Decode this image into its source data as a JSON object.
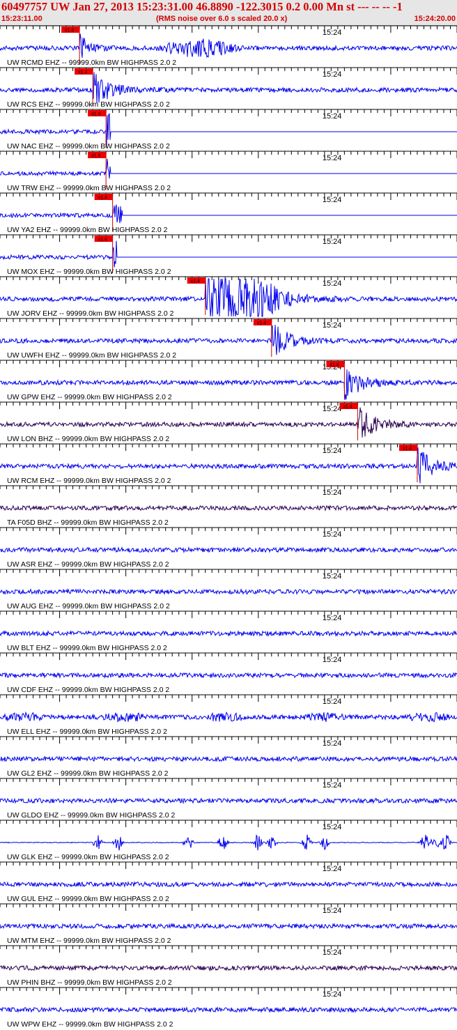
{
  "header": {
    "title": "60497757 UW Jan 27, 2013 15:23:31.00   46.8890 -122.3015  0.2 0.00 Mn st --- -- --   -1",
    "start_time": "15:23:11.00",
    "rms_note": "(RMS noise over 6.0 s scaled 20.0 x)",
    "end_time": "15:24:20.00"
  },
  "colors": {
    "header_text": "#d40000",
    "header_bg": "#e6e6e6",
    "trace_ehz": "#0000ee",
    "trace_bhz": "#2a0050",
    "pick_box": "#ee0000",
    "pick_line": "#cc0000",
    "axis": "#000000"
  },
  "chart_data": {
    "type": "line",
    "title": "60497757 UW Jan 27, 2013 15:23:31.00   46.8890 -122.3015  0.2 0.00 Mn st --- -- --   -1",
    "x_range": [
      "15:23:11.00",
      "15:24:20.00"
    ],
    "x_tick_label": "15:24",
    "pick_label": "x1.4",
    "traces": [
      {
        "label": "UW RCMD EHZ -- 99999.0km BW  HIGHPASS  2.0  2",
        "channel": "EHZ",
        "pick": "15:23:23",
        "pattern": "noisy-event"
      },
      {
        "label": "UW RCS EHZ -- 99999.0km BW  HIGHPASS  2.0  2",
        "channel": "EHZ",
        "pick": "15:23:25",
        "pattern": "event"
      },
      {
        "label": "UW NAC EHZ -- 99999.0km BW  HIGHPASS  2.0  2",
        "channel": "EHZ",
        "pick": "15:23:27",
        "pattern": "spike-flat"
      },
      {
        "label": "UW TRW EHZ -- 99999.0km BW  HIGHPASS  2.0  2",
        "channel": "EHZ",
        "pick": "15:23:27",
        "pattern": "spike-flat"
      },
      {
        "label": "UW YA2 EHZ -- 99999.0km BW  HIGHPASS  2.0  2",
        "channel": "EHZ",
        "pick": "15:23:28",
        "pattern": "burst-flat"
      },
      {
        "label": "UW MOX EHZ -- 99999.0km BW  HIGHPASS  2.0  2",
        "channel": "EHZ",
        "pick": "15:23:28",
        "pattern": "spike-flat"
      },
      {
        "label": "UW JORV EHZ -- 99999.0km BW  HIGHPASS  2.0  2",
        "channel": "EHZ",
        "pick": "15:23:42",
        "pattern": "big-event"
      },
      {
        "label": "UW UWFH EHZ -- 99999.0km BW  HIGHPASS  2.0  2",
        "channel": "EHZ",
        "pick": "15:23:52",
        "pattern": "event"
      },
      {
        "label": "UW GPW EHZ -- 99999.0km BW  HIGHPASS  2.0  2",
        "channel": "EHZ",
        "pick": "15:24:03",
        "pattern": "event"
      },
      {
        "label": "UW LON BHZ -- 99999.0km BW  HIGHPASS  2.0  2",
        "channel": "BHZ",
        "pick": "15:24:05",
        "pattern": "event"
      },
      {
        "label": "UW RCM EHZ -- 99999.0km BW  HIGHPASS  2.0  2",
        "channel": "EHZ",
        "pick": "15:24:14",
        "pattern": "event"
      },
      {
        "label": "TA F05D BHZ -- 99999.0km BW  HIGHPASS  2.0  2",
        "channel": "BHZ",
        "pick": null,
        "pattern": "noise"
      },
      {
        "label": "UW ASR EHZ -- 99999.0km BW  HIGHPASS  2.0  2",
        "channel": "EHZ",
        "pick": null,
        "pattern": "noise"
      },
      {
        "label": "UW AUG EHZ -- 99999.0km BW  HIGHPASS  2.0  2",
        "channel": "EHZ",
        "pick": null,
        "pattern": "noise"
      },
      {
        "label": "UW BLT EHZ -- 99999.0km BW  HIGHPASS  2.0  2",
        "channel": "EHZ",
        "pick": null,
        "pattern": "noise"
      },
      {
        "label": "UW CDF EHZ -- 99999.0km BW  HIGHPASS  2.0  2",
        "channel": "EHZ",
        "pick": null,
        "pattern": "noise"
      },
      {
        "label": "UW ELL EHZ -- 99999.0km BW  HIGHPASS  2.0  2",
        "channel": "EHZ",
        "pick": null,
        "pattern": "noisy"
      },
      {
        "label": "UW GL2 EHZ -- 99999.0km BW  HIGHPASS  2.0  2",
        "channel": "EHZ",
        "pick": null,
        "pattern": "noise"
      },
      {
        "label": "UW GLDO EHZ -- 99999.0km BW  HIGHPASS  2.0  2",
        "channel": "EHZ",
        "pick": null,
        "pattern": "noise"
      },
      {
        "label": "UW GLK EHZ -- 99999.0km BW  HIGHPASS  2.0  2",
        "channel": "EHZ",
        "pick": null,
        "pattern": "bursty"
      },
      {
        "label": "UW GUL EHZ -- 99999.0km BW  HIGHPASS  2.0  2",
        "channel": "EHZ",
        "pick": null,
        "pattern": "noise"
      },
      {
        "label": "UW MTM EHZ -- 99999.0km BW  HIGHPASS  2.0  2",
        "channel": "EHZ",
        "pick": null,
        "pattern": "noise"
      },
      {
        "label": "UW PHIN BHZ -- 99999.0km BW  HIGHPASS  2.0  2",
        "channel": "BHZ",
        "pick": null,
        "pattern": "noise"
      },
      {
        "label": "UW WPW EHZ -- 99999.0km BW  HIGHPASS  2.0  2",
        "channel": "EHZ",
        "pick": null,
        "pattern": "noise"
      }
    ]
  }
}
